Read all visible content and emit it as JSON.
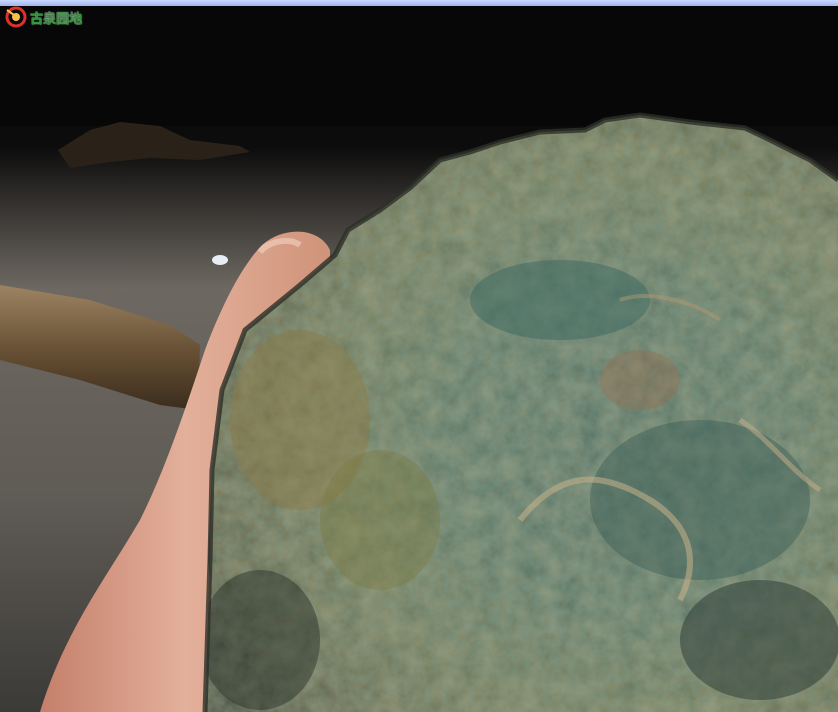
{
  "watermark": {
    "text": "古泉园地",
    "icon": "site-logo-icon",
    "color": "#2f8f3a"
  },
  "colors": {
    "background_dark": "#0b0b0b",
    "floor": "#6e6a63",
    "skin": "#d9a48c",
    "patina_green": "#4f6d5e",
    "patina_ochre": "#8a7a4e",
    "wood_handle": "#6a5236"
  }
}
